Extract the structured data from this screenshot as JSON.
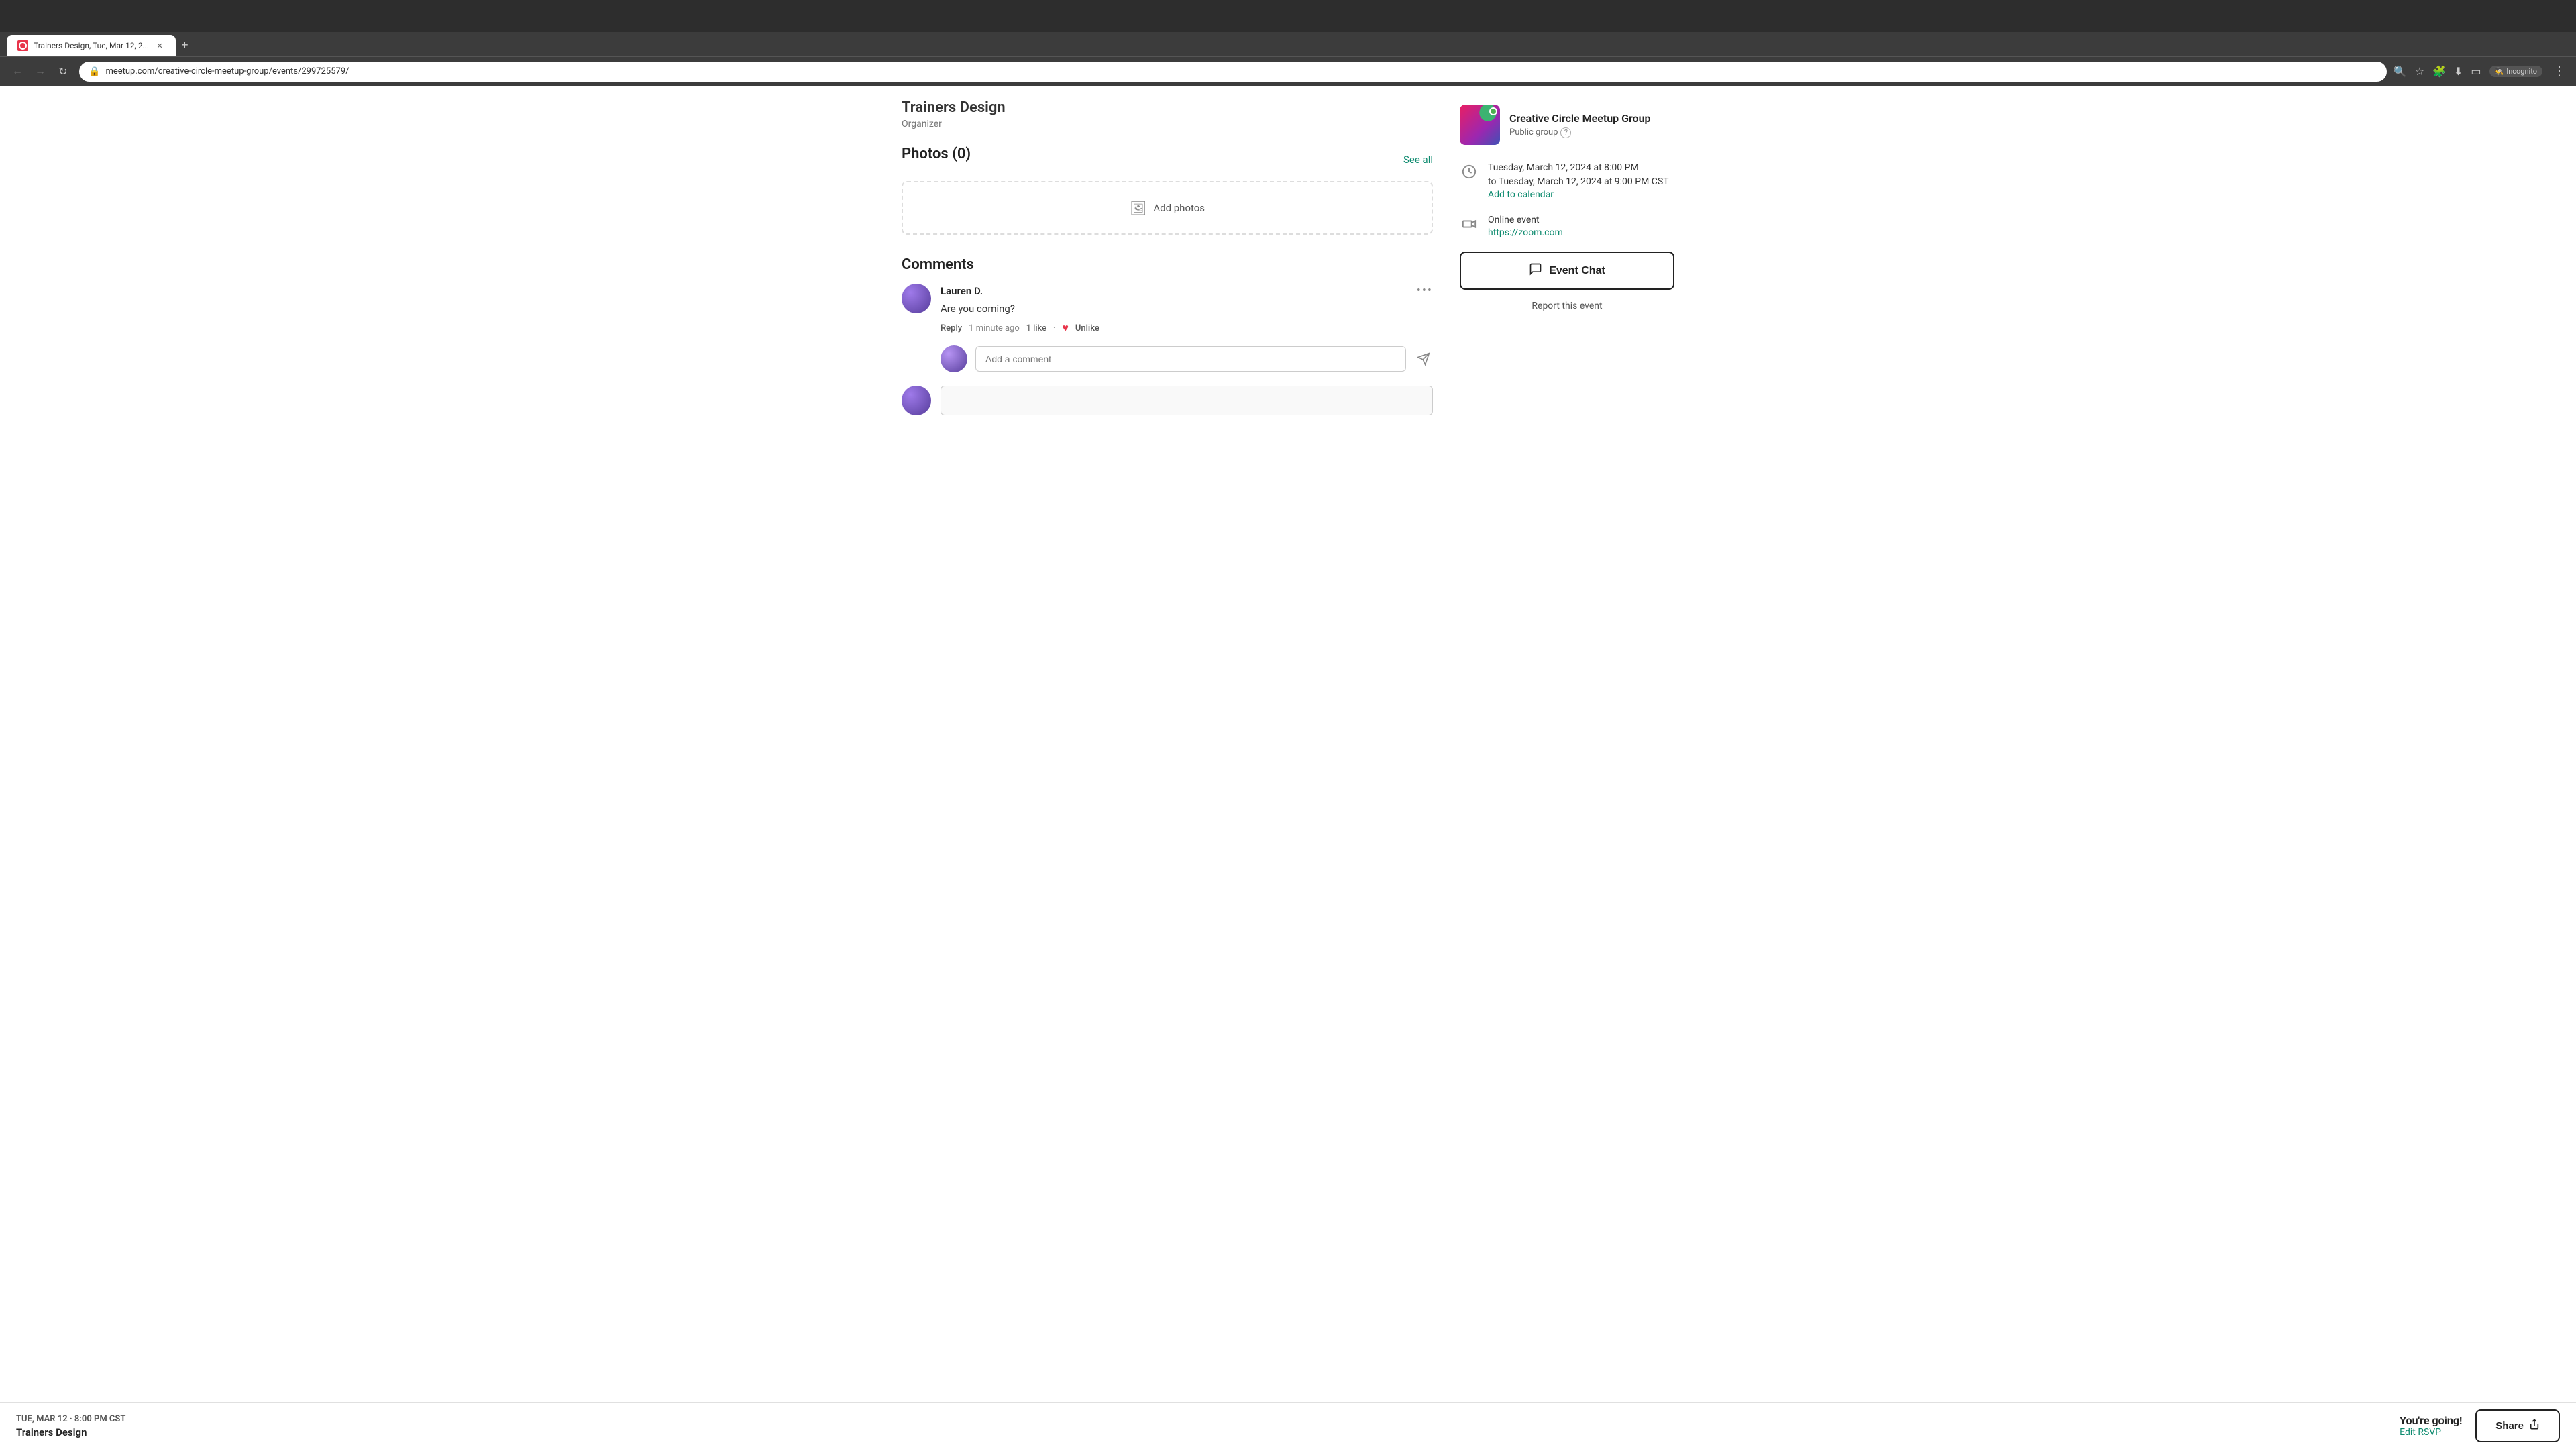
{
  "browser": {
    "tab_title": "Trainers Design, Tue, Mar 12, 2...",
    "tab_favicon": "M",
    "url": "meetup.com/creative-circle-meetup-group/events/299725579/",
    "incognito_label": "Incognito"
  },
  "page": {
    "organizer_name": "Trainers Design",
    "organizer_label": "Organizer",
    "photos_section_title": "Photos (0)",
    "photos_see_all": "See all",
    "add_photos_label": "Add photos",
    "comments_section_title": "Comments",
    "comment": {
      "author": "Lauren D.",
      "text": "Are you coming?",
      "reply_label": "Reply",
      "time_ago": "1 minute ago",
      "like_count": "1 like",
      "unlike_label": "Unlike",
      "menu": "•••"
    },
    "reply_placeholder": "Add a comment",
    "sidebar": {
      "group_name": "Creative Circle Meetup Group",
      "group_type": "Public group",
      "event_date": "Tuesday, March 12, 2024 at 8:00 PM",
      "event_date_end": "to Tuesday, March 12, 2024 at 9:00 PM CST",
      "add_to_calendar": "Add to calendar",
      "event_type": "Online event",
      "zoom_link": "https://zoom.com",
      "event_chat_btn": "Event Chat",
      "report_event": "Report this event"
    },
    "bottom_bar": {
      "date_label": "TUE, MAR 12 · 8:00 PM CST",
      "event_title": "Trainers Design",
      "going_label": "You're going!",
      "edit_rsvp": "Edit RSVP",
      "share_label": "Share"
    }
  }
}
